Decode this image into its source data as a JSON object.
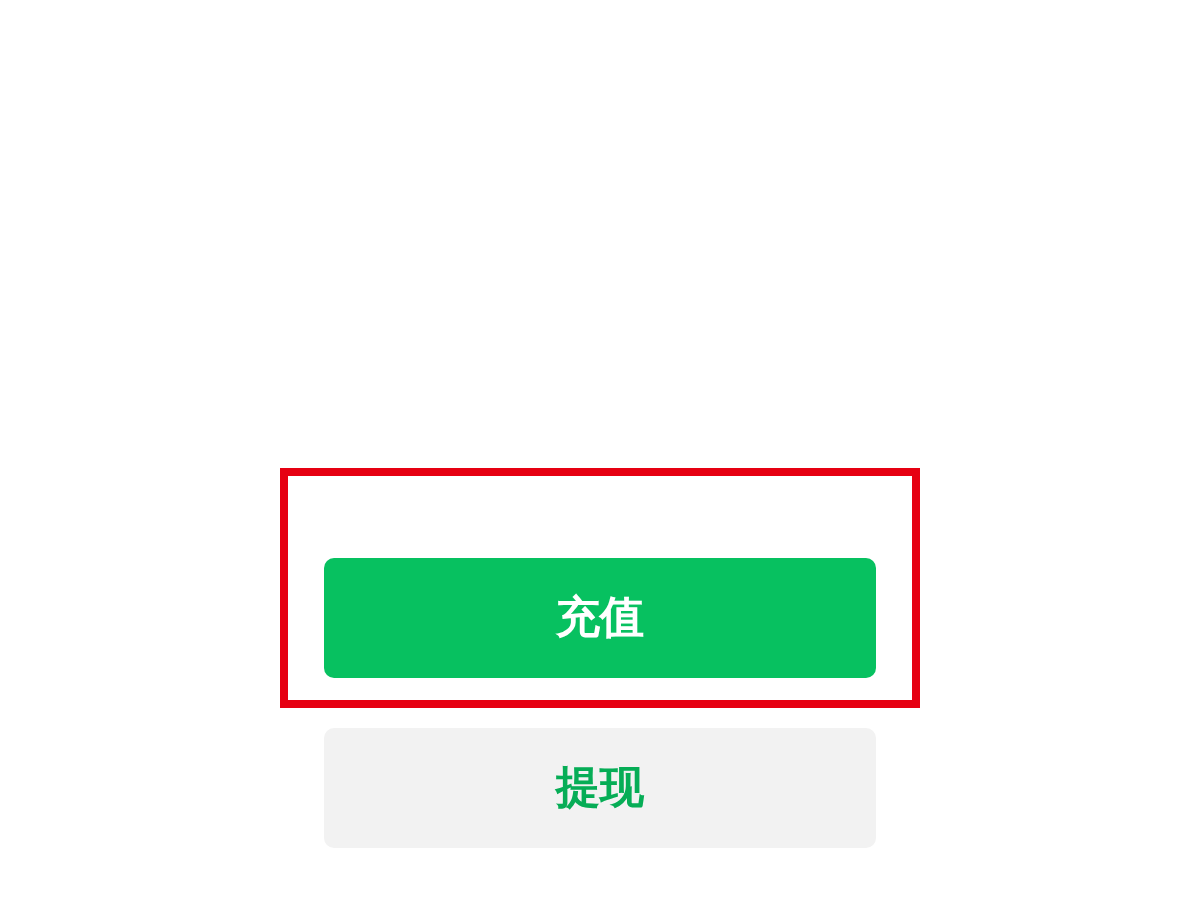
{
  "buttons": [
    {
      "label": "充值",
      "kind": "primary",
      "highlighted": true
    },
    {
      "label": "提现",
      "kind": "secondary",
      "highlighted": false
    }
  ]
}
